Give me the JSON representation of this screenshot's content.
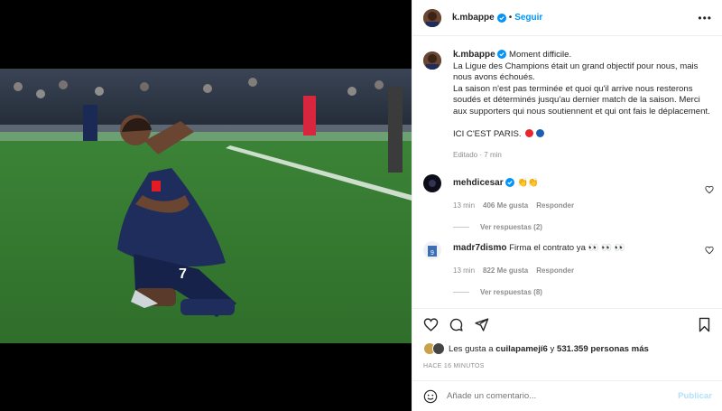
{
  "colors": {
    "accent": "#0095f6",
    "muted": "#8e8e8e",
    "text": "#262626",
    "publish_disabled": "#b2dffc"
  },
  "post": {
    "image_description_icon": "photo",
    "header": {
      "username": "k.mbappe",
      "separator": "•",
      "follow_label": "Seguir",
      "more_icon": "more-horizontal-icon"
    },
    "caption": {
      "username": "k.mbappe",
      "lines": [
        "Moment difficile.",
        "La Ligue des Champions était un grand objectif pour nous, mais nous avons échoués.",
        "La saison n'est pas terminée et quoi qu'il arrive nous resterons soudés et déterminés jusqu'au dernier match de la saison. Merci aux supporters qui nous soutiennent et qui ont fais le déplacement.",
        "ICI C'EST PARIS."
      ],
      "edited_label": "Editado",
      "edited_separator": "·",
      "time": "7 min"
    },
    "comments": [
      {
        "username": "mehdicesar",
        "text": "👏👏",
        "time": "13 min",
        "likes": "406 Me gusta",
        "reply_label": "Responder",
        "view_replies": "Ver respuestas (2)"
      },
      {
        "username": "madr7dismo",
        "text": "Firma el contrato ya 👀 👀 👀",
        "time": "13 min",
        "likes": "822 Me gusta",
        "reply_label": "Responder",
        "view_replies": "Ver respuestas (8)"
      }
    ],
    "likes": {
      "prefix": "Les gusta a",
      "user": "cuilapamejí6",
      "connector": "y",
      "count": "531.359 personas más"
    },
    "time_ago": "HACE 16 MINUTOS",
    "add_comment": {
      "placeholder": "Añade un comentario...",
      "publish_label": "Publicar"
    }
  }
}
